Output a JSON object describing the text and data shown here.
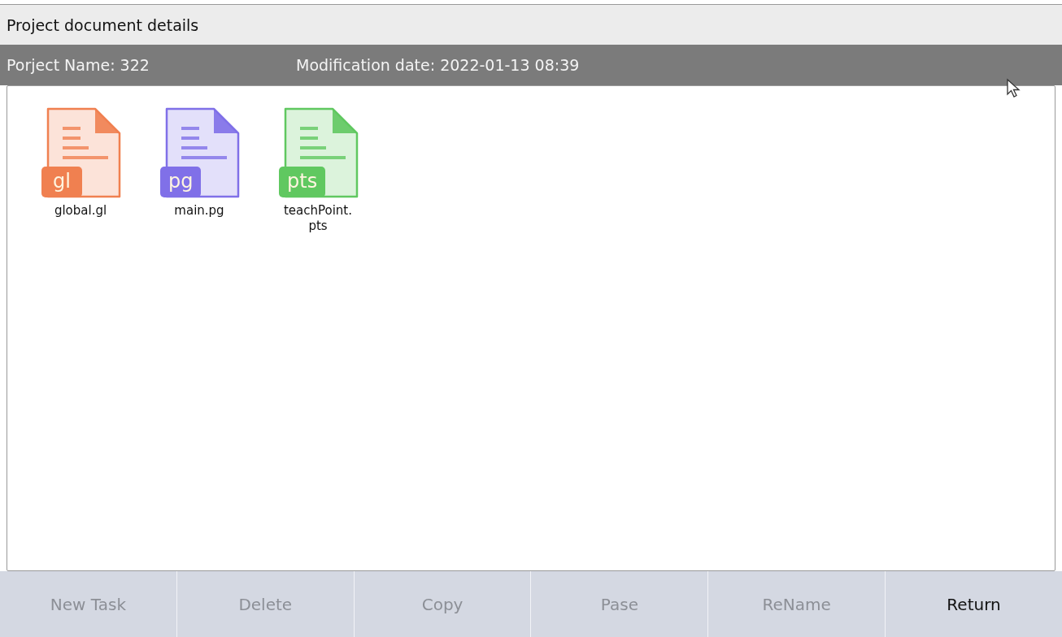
{
  "window": {
    "title": "Project document details"
  },
  "info_bar": {
    "project_name": "Porject Name: 322",
    "modification_date": "Modification date: 2022-01-13 08:39"
  },
  "files": [
    {
      "name": "global.gl",
      "badge": "gl",
      "color": "#f08050"
    },
    {
      "name": "main.pg",
      "badge": "pg",
      "color": "#8070e8"
    },
    {
      "name": "teachPoint.pts",
      "badge": "pts",
      "color": "#60c860"
    }
  ],
  "buttons": [
    {
      "label": "New Task",
      "disabled": true
    },
    {
      "label": "Delete",
      "disabled": true
    },
    {
      "label": "Copy",
      "disabled": true
    },
    {
      "label": "Pase",
      "disabled": true
    },
    {
      "label": "ReName",
      "disabled": true
    },
    {
      "label": "Return",
      "disabled": false
    }
  ]
}
